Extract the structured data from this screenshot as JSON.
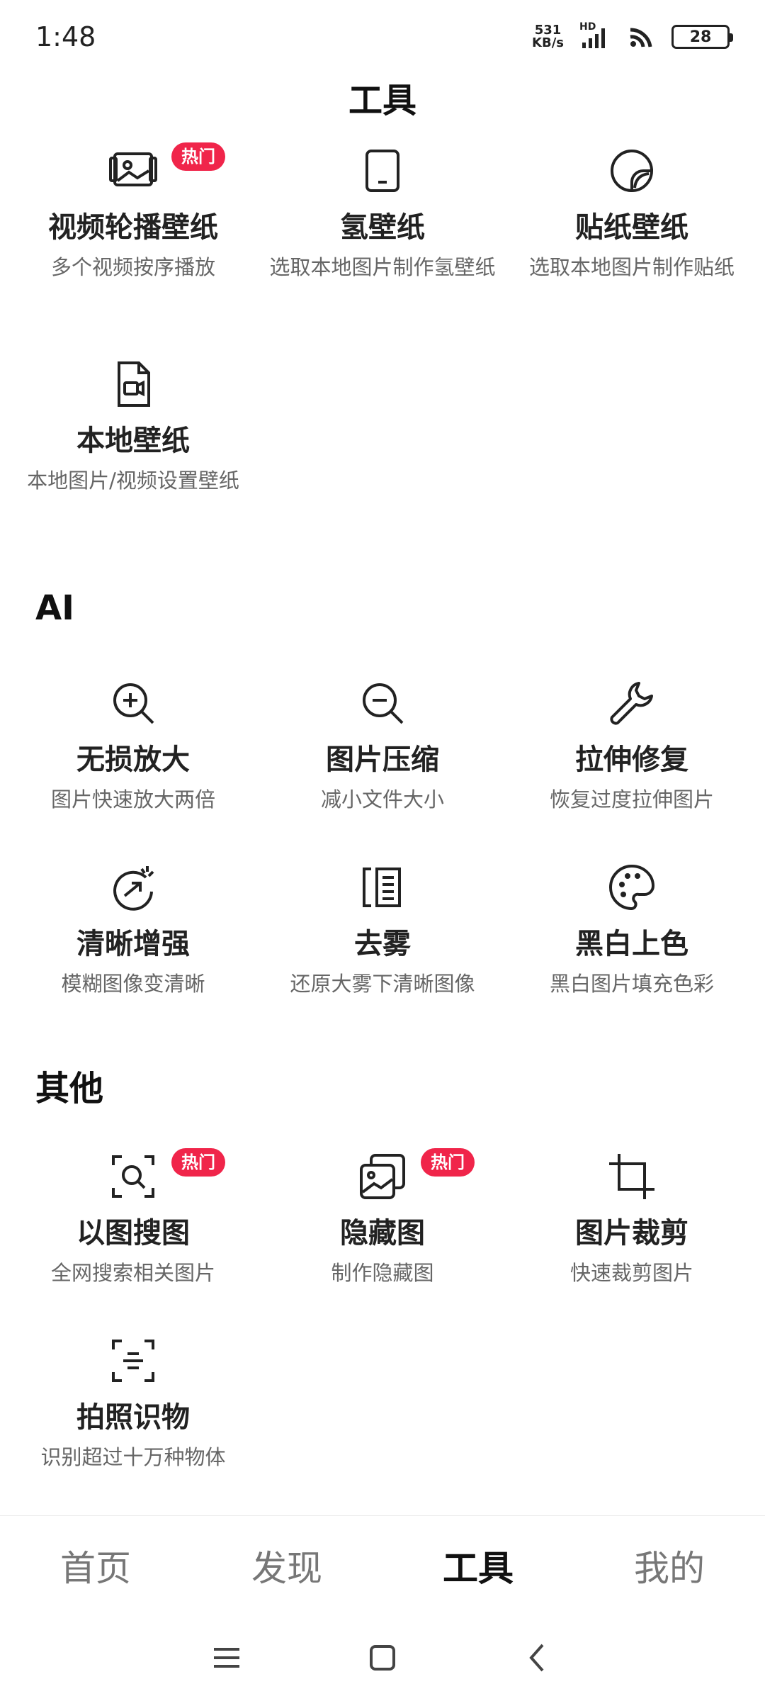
{
  "status_bar": {
    "time": "1:48",
    "net_speed_value": "531",
    "net_speed_unit": "KB/s",
    "hd_label": "HD",
    "battery": "28"
  },
  "page": {
    "title": "工具"
  },
  "badges": {
    "hot": "热门"
  },
  "tools_top": [
    {
      "name": "视频轮播壁纸",
      "desc": "多个视频按序播放",
      "icon": "image-gallery-icon",
      "hot": true
    },
    {
      "name": "氢壁纸",
      "desc": "选取本地图片制作氢壁纸",
      "icon": "phone-icon",
      "hot": false
    },
    {
      "name": "贴纸壁纸",
      "desc": "选取本地图片制作贴纸",
      "icon": "sticker-icon",
      "hot": false
    },
    {
      "name": "本地壁纸",
      "desc": "本地图片/视频设置壁纸",
      "icon": "video-file-icon",
      "hot": false
    }
  ],
  "sections": {
    "ai": "AI",
    "other": "其他"
  },
  "tools_ai": [
    {
      "name": "无损放大",
      "desc": "图片快速放大两倍",
      "icon": "zoom-in-icon"
    },
    {
      "name": "图片压缩",
      "desc": "减小文件大小",
      "icon": "zoom-out-icon"
    },
    {
      "name": "拉伸修复",
      "desc": "恢复过度拉伸图片",
      "icon": "wrench-icon"
    },
    {
      "name": "清晰增强",
      "desc": "模糊图像变清晰",
      "icon": "sparkle-arrow-icon"
    },
    {
      "name": "去雾",
      "desc": "还原大雾下清晰图像",
      "icon": "dehaze-icon"
    },
    {
      "name": "黑白上色",
      "desc": "黑白图片填充色彩",
      "icon": "palette-icon"
    }
  ],
  "tools_other": [
    {
      "name": "以图搜图",
      "desc": "全网搜索相关图片",
      "icon": "image-search-icon",
      "hot": true
    },
    {
      "name": "隐藏图",
      "desc": "制作隐藏图",
      "icon": "hidden-image-icon",
      "hot": true
    },
    {
      "name": "图片裁剪",
      "desc": "快速裁剪图片",
      "icon": "crop-icon",
      "hot": false
    },
    {
      "name": "拍照识物",
      "desc": "识别超过十万种物体",
      "icon": "scan-icon",
      "hot": false
    }
  ],
  "bottom_nav": [
    {
      "label": "首页",
      "active": false
    },
    {
      "label": "发现",
      "active": false
    },
    {
      "label": "工具",
      "active": true
    },
    {
      "label": "我的",
      "active": false
    }
  ],
  "colors": {
    "badge": "#f0254a",
    "text_primary": "#222222",
    "text_secondary": "#666666"
  }
}
